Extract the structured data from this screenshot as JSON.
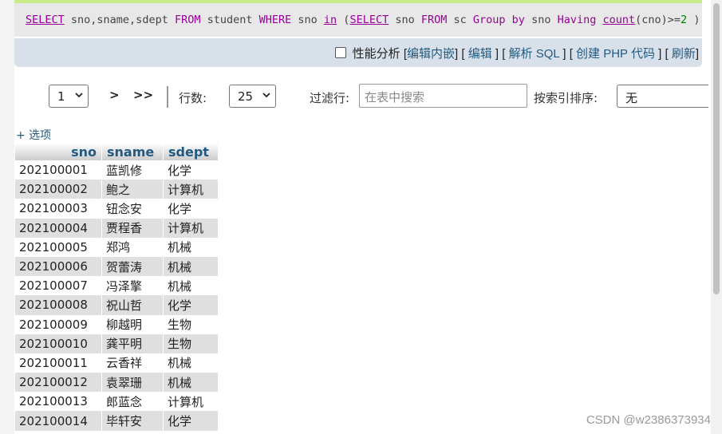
{
  "sql_query": {
    "parts": [
      "SELECT",
      " sno,sname,sdept ",
      "FROM",
      " student ",
      "WHERE",
      " sno ",
      "in",
      " (",
      "SELECT",
      " sno ",
      "FROM",
      " sc ",
      "Group",
      " ",
      "by",
      " sno ",
      "Having",
      " ",
      "count",
      "(cno)>=",
      "2",
      " )"
    ]
  },
  "toolbar": {
    "profiling_label": "性能分析",
    "links": [
      "编辑内嵌",
      "编辑",
      "解析 SQL",
      "创建 PHP 代码",
      "刷新"
    ]
  },
  "navigation": {
    "page_select_value": "1",
    "next_label": ">",
    "last_label": ">>",
    "rows_label": "行数:",
    "rows_value": "25",
    "filter_label": "过滤行:",
    "filter_placeholder": "在表中搜索",
    "sort_label": "按索引排序:",
    "sort_value": "无"
  },
  "options_link": "+ 选项",
  "table": {
    "headers": [
      "sno",
      "sname",
      "sdept"
    ],
    "rows": [
      [
        "202100001",
        "蓝凯修",
        "化学"
      ],
      [
        "202100002",
        "鲍之",
        "计算机"
      ],
      [
        "202100003",
        "钮念安",
        "化学"
      ],
      [
        "202100004",
        "贾程香",
        "计算机"
      ],
      [
        "202100005",
        "郑鸿",
        "机械"
      ],
      [
        "202100006",
        "贺蕾涛",
        "机械"
      ],
      [
        "202100007",
        "冯泽擎",
        "机械"
      ],
      [
        "202100008",
        "祝山哲",
        "化学"
      ],
      [
        "202100009",
        "柳越明",
        "生物"
      ],
      [
        "202100010",
        "龚平明",
        "生物"
      ],
      [
        "202100011",
        "云香祥",
        "机械"
      ],
      [
        "202100012",
        "袁翠珊",
        "机械"
      ],
      [
        "202100013",
        "郎蓝念",
        "计算机"
      ],
      [
        "202100014",
        "毕轩安",
        "化学"
      ]
    ]
  },
  "watermark": "CSDN @w2386373934",
  "colors": {
    "link": "#235a81",
    "keyword": "#990099",
    "number": "#008000",
    "accent_bar": "#c8ec89"
  },
  "icons": {
    "dropdown": "chevron-down-icon"
  }
}
